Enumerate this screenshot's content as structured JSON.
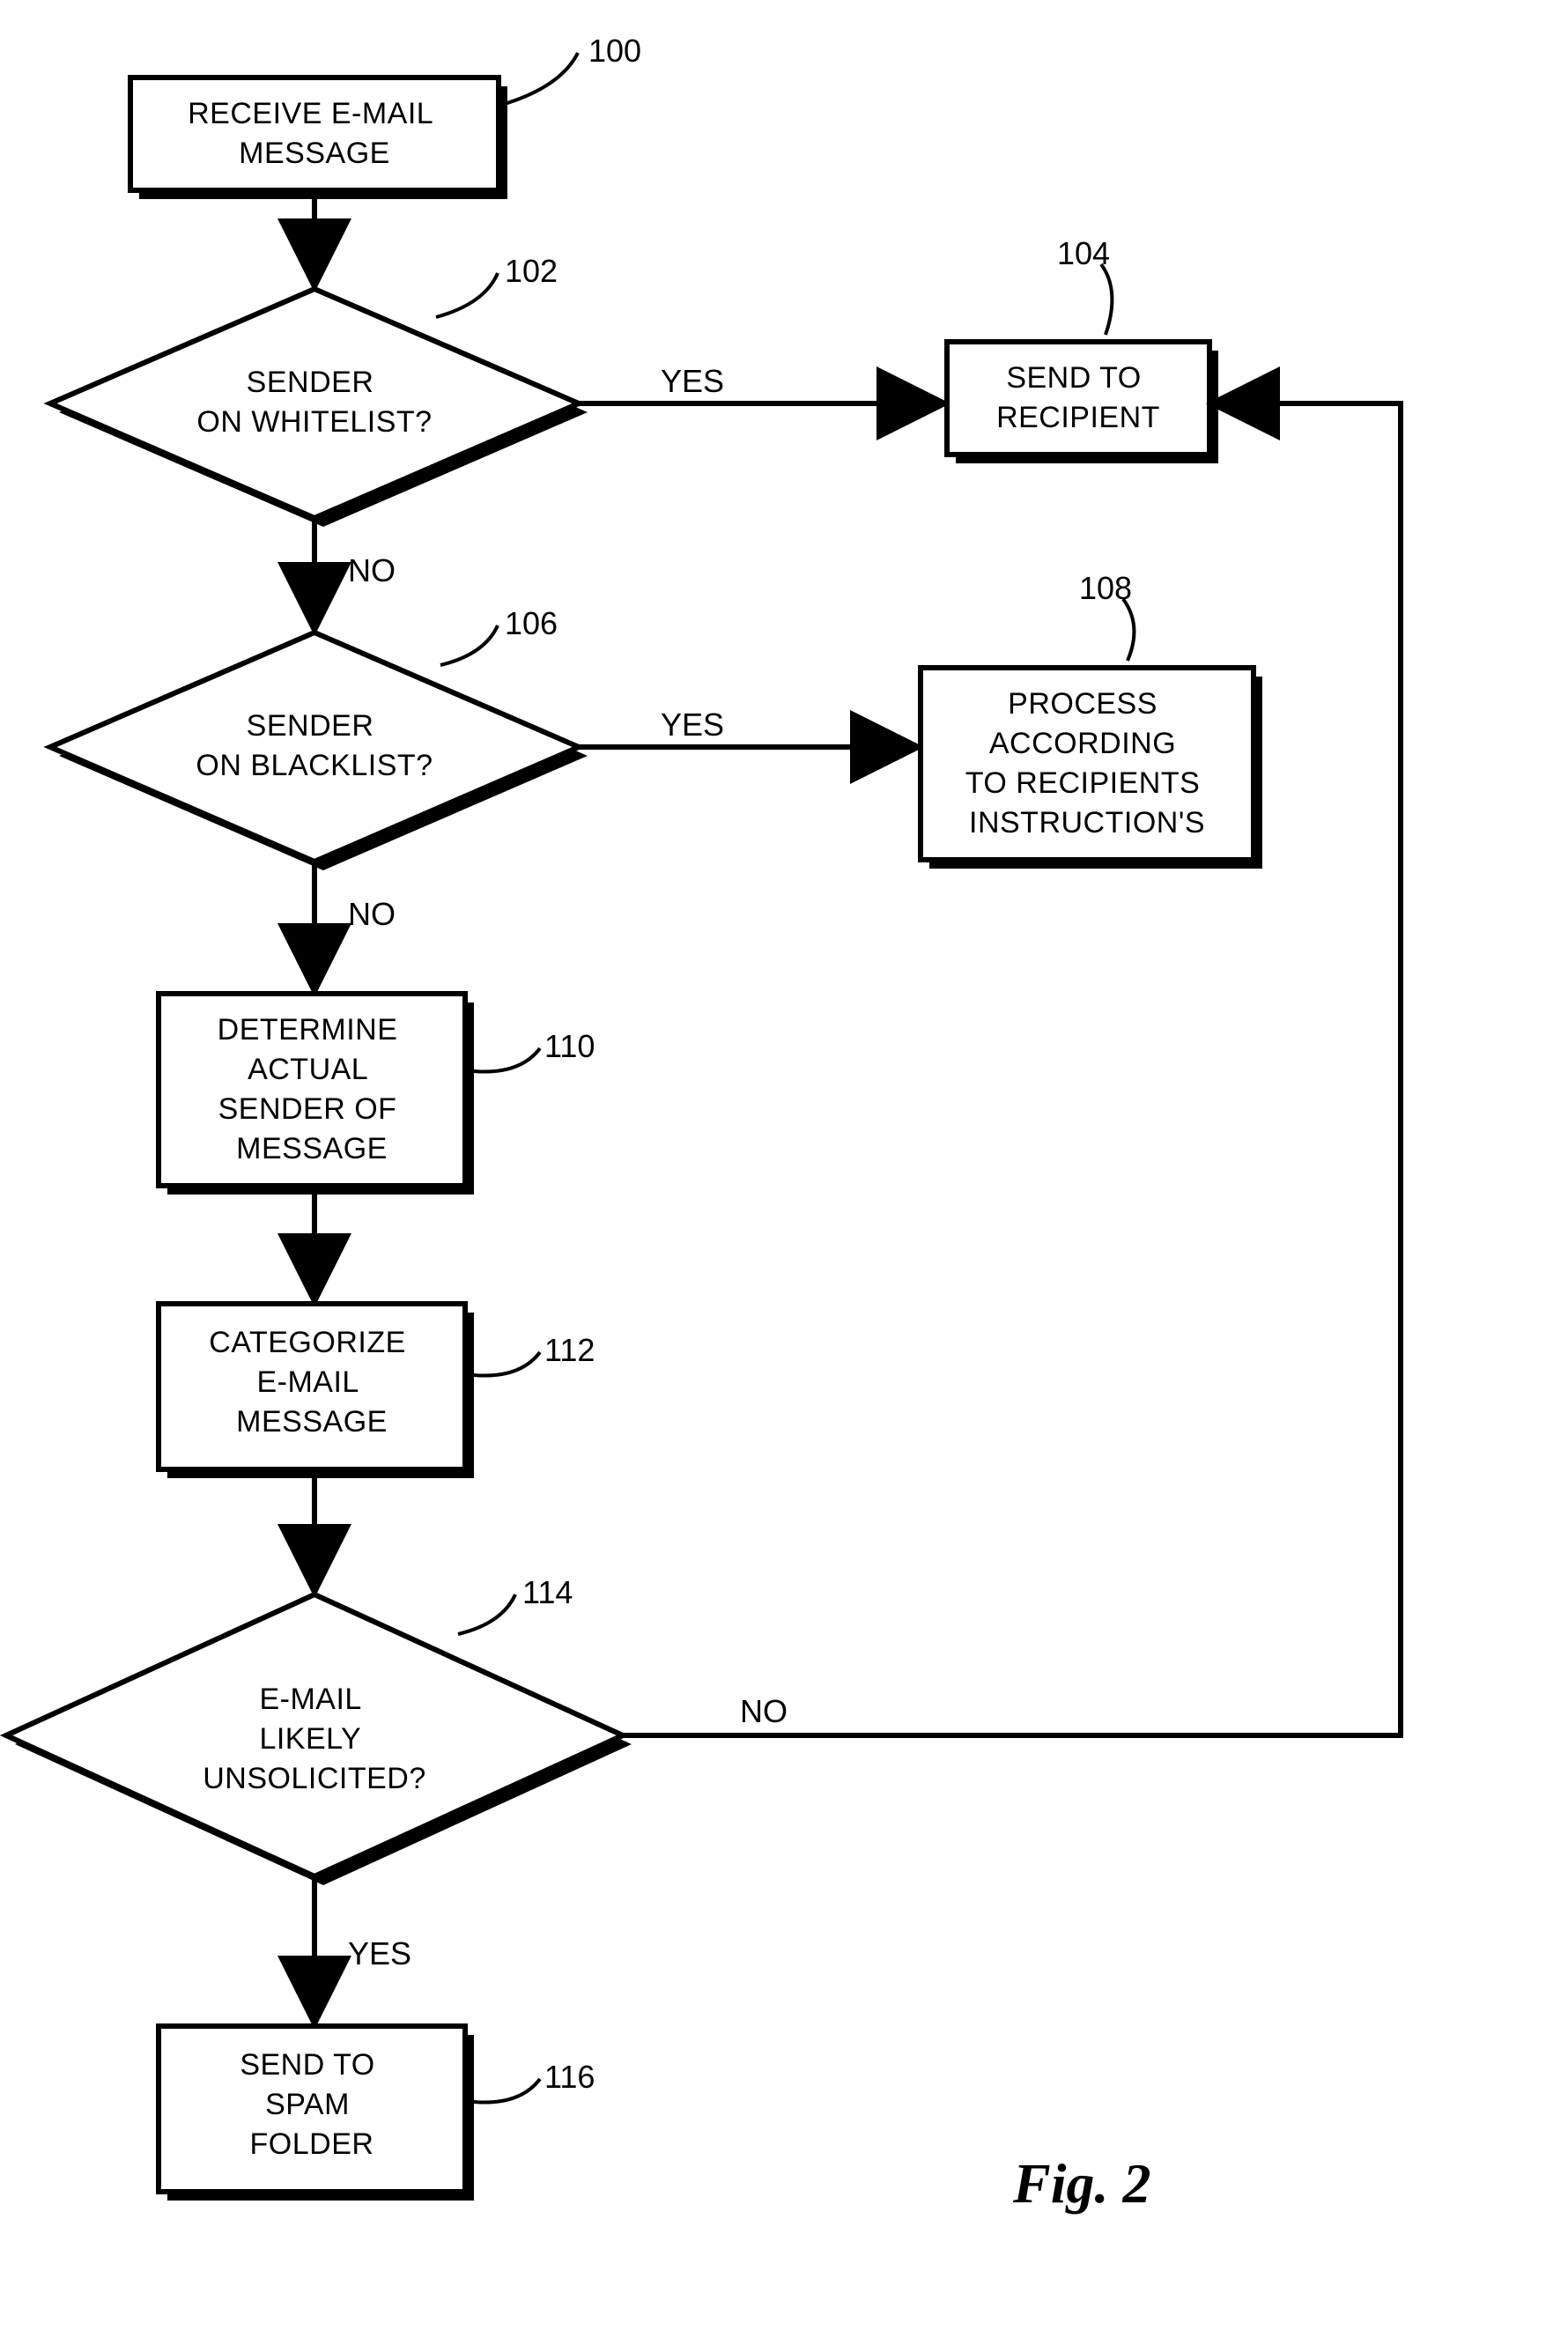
{
  "nodes": {
    "n100": {
      "ref": "100",
      "lines": [
        "RECEIVE E-MAIL",
        "MESSAGE"
      ]
    },
    "n102": {
      "ref": "102",
      "lines": [
        "SENDER",
        "ON WHITELIST?"
      ]
    },
    "n104": {
      "ref": "104",
      "lines": [
        "SEND TO",
        "RECIPIENT"
      ]
    },
    "n106": {
      "ref": "106",
      "lines": [
        "SENDER",
        "ON BLACKLIST?"
      ]
    },
    "n108": {
      "ref": "108",
      "lines": [
        "PROCESS",
        "ACCORDING",
        "TO RECIPIENTS",
        "INSTRUCTION'S"
      ]
    },
    "n110": {
      "ref": "110",
      "lines": [
        "DETERMINE",
        "ACTUAL",
        "SENDER OF",
        "MESSAGE"
      ]
    },
    "n112": {
      "ref": "112",
      "lines": [
        "CATEGORIZE",
        "E-MAIL",
        "MESSAGE"
      ]
    },
    "n114": {
      "ref": "114",
      "lines": [
        "E-MAIL",
        "LIKELY",
        "UNSOLICITED?"
      ]
    },
    "n116": {
      "ref": "116",
      "lines": [
        "SEND TO",
        "SPAM",
        "FOLDER"
      ]
    }
  },
  "edges": {
    "e102_104": "YES",
    "e102_106": "NO",
    "e106_108": "YES",
    "e106_110": "NO",
    "e114_no": "NO",
    "e114_116": "YES"
  },
  "figure_caption": "Fig. 2"
}
